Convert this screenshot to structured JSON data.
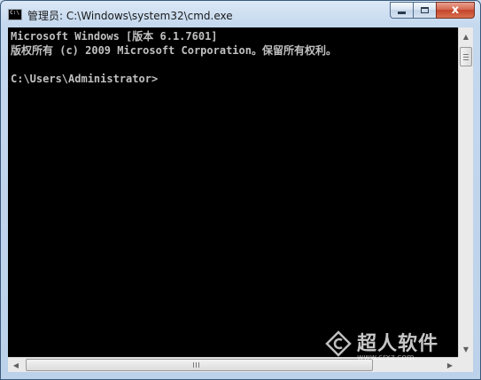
{
  "window": {
    "title": "管理员: C:\\Windows\\system32\\cmd.exe",
    "icon": "cmd-icon",
    "icon_text": "C:\\"
  },
  "caption_buttons": {
    "minimize": "minimize-icon",
    "maximize": "maximize-icon",
    "close_label": "x"
  },
  "console": {
    "lines": [
      "Microsoft Windows [版本 6.1.7601]",
      "版权所有 (c) 2009 Microsoft Corporation。保留所有权利。",
      "",
      "C:\\Users\\Administrator>"
    ],
    "text_color": "#c0c0c0",
    "background": "#000000"
  },
  "scrollbars": {
    "vertical_up": "▲",
    "vertical_down": "▼",
    "horizontal_left": "◀",
    "horizontal_right": "▶"
  },
  "watermark": {
    "brand": "超人软件",
    "url": "www.crxz.com"
  }
}
